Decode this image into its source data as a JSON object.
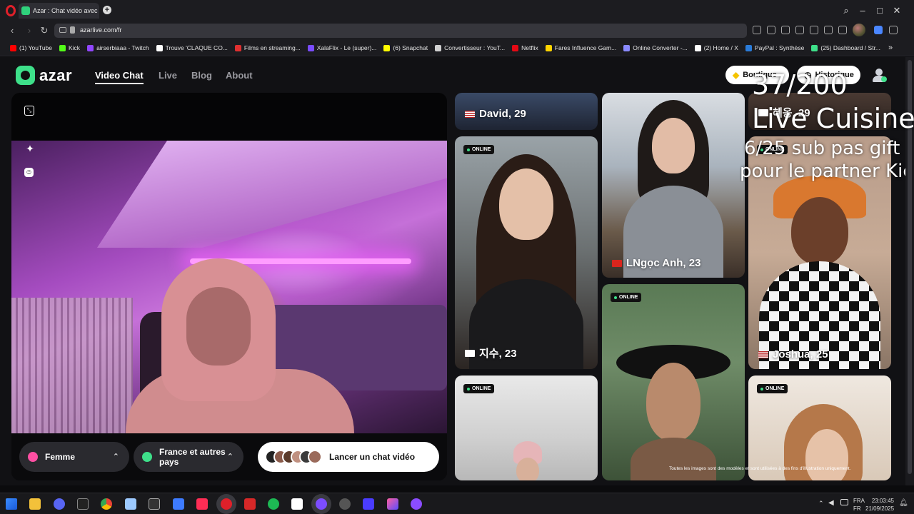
{
  "browser": {
    "tab_title": "Azar : Chat vidéo avec de",
    "url": "azarlive.com/fr",
    "bookmarks": [
      {
        "label": "(1) YouTube",
        "color": "#ff0000"
      },
      {
        "label": "Kick",
        "color": "#53fc18"
      },
      {
        "label": "airserbiaaa - Twitch",
        "color": "#9146ff"
      },
      {
        "label": "Trouve 'CLAQUE CO...",
        "color": "#ffffff"
      },
      {
        "label": "Films en streaming...",
        "color": "#e03030"
      },
      {
        "label": "XalaFlix - Le (super)...",
        "color": "#7a4cff"
      },
      {
        "label": "(6) Snapchat",
        "color": "#fffc00"
      },
      {
        "label": "Convertisseur : YouT...",
        "color": "#d0d0d0"
      },
      {
        "label": "Netflix",
        "color": "#e50914"
      },
      {
        "label": "Fares Influence Gam...",
        "color": "#ffd400"
      },
      {
        "label": "Online Converter -...",
        "color": "#8a8aff"
      },
      {
        "label": "(2) Home / X",
        "color": "#ffffff"
      },
      {
        "label": "PayPal : Synthèse",
        "color": "#2a7bd8"
      },
      {
        "label": "(25) Dashboard / Str...",
        "color": "#3ee08a"
      }
    ],
    "more_label": "»"
  },
  "site": {
    "logo": "azar",
    "nav": [
      "Video Chat",
      "Live",
      "Blog",
      "About"
    ],
    "shop_label": "Boutique",
    "history_label": "Historique",
    "accent": "#3ee08a"
  },
  "filters": {
    "gender": "Femme",
    "country": "France et autres pays",
    "launch": "Lancer un chat vidéo"
  },
  "cards": [
    {
      "name": "David, 29",
      "flag": "us",
      "online": false
    },
    {
      "name": "LNgọc Anh, 23",
      "flag": "vn",
      "online": false
    },
    {
      "name": "혜옹, 29",
      "flag": "kr",
      "online": false
    },
    {
      "name": "지수, 23",
      "flag": "kr",
      "online": true
    },
    {
      "name": "Joshua, 25",
      "flag": "us",
      "online": true
    },
    {
      "name": "",
      "flag": "",
      "online": true
    },
    {
      "name": "",
      "flag": "",
      "online": true
    },
    {
      "name": "",
      "flag": "",
      "online": true
    }
  ],
  "online_label": "ONLINE",
  "disclaimer": "Toutes les images sont des modèles et sont utilisées à des fins d'illustration uniquement.",
  "overlay": {
    "counter": "37/200",
    "line1": "Live Cuisine",
    "line2": "6/25 sub pas gift",
    "line3": "pour le partner Kick"
  },
  "taskbar": {
    "lang_top": "FRA",
    "lang_bottom": "FR",
    "time": "23:03:45",
    "date": "21/09/2025"
  }
}
